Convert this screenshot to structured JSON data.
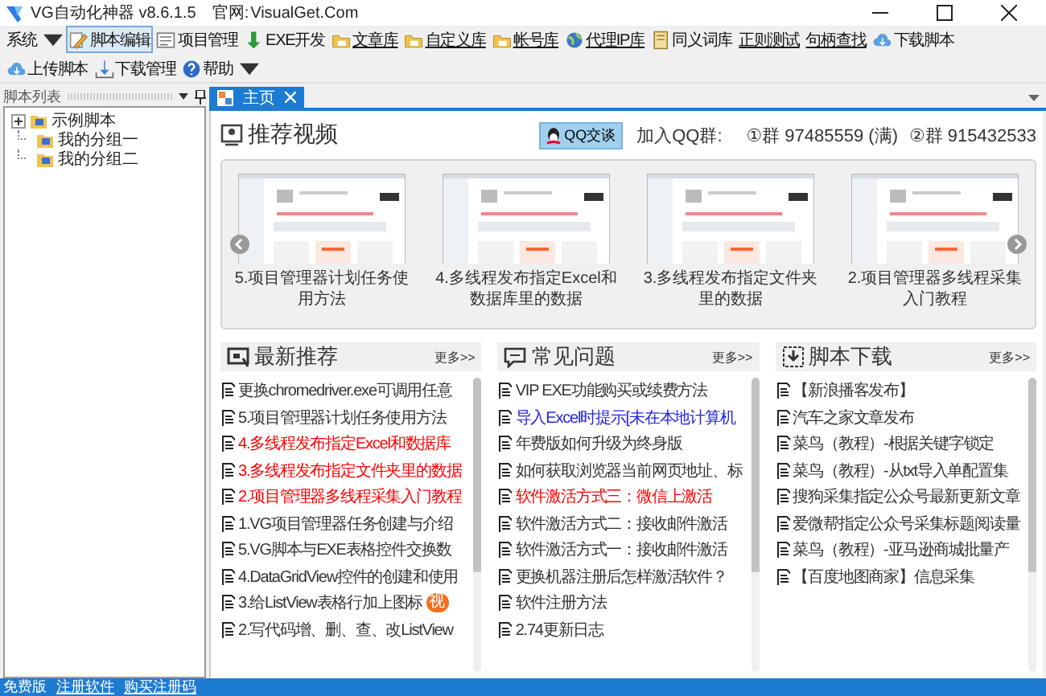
{
  "window": {
    "title": "VG自动化神器 v8.6.1.5",
    "site_label": "官网:",
    "site": "VisualGet.Com"
  },
  "toolbar": [
    {
      "label": "系统",
      "dropdown": true,
      "underlined": false,
      "selected": false
    },
    {
      "label": "脚本编辑",
      "dropdown": false,
      "underlined": false,
      "selected": true
    },
    {
      "label": "项目管理",
      "dropdown": false,
      "underlined": false,
      "selected": false
    },
    {
      "label": "EXE开发",
      "dropdown": false,
      "underlined": false,
      "selected": false
    },
    {
      "label": "文章库",
      "dropdown": false,
      "underlined": true,
      "selected": false
    },
    {
      "label": "自定义库",
      "dropdown": false,
      "underlined": true,
      "selected": false
    },
    {
      "label": "帐号库",
      "dropdown": false,
      "underlined": true,
      "selected": false
    },
    {
      "label": "代理IP库",
      "dropdown": false,
      "underlined": true,
      "selected": false
    },
    {
      "label": "同义词库",
      "dropdown": false,
      "underlined": false,
      "selected": false
    },
    {
      "label": "正则测试",
      "dropdown": false,
      "underlined": true,
      "selected": false
    },
    {
      "label": "句柄查找",
      "dropdown": false,
      "underlined": true,
      "selected": false
    },
    {
      "label": "下载脚本",
      "dropdown": false,
      "underlined": false,
      "selected": false
    },
    {
      "label": "上传脚本",
      "dropdown": false,
      "underlined": false,
      "selected": false
    },
    {
      "label": "下载管理",
      "dropdown": false,
      "underlined": false,
      "selected": false
    },
    {
      "label": "帮助",
      "dropdown": true,
      "underlined": false,
      "selected": false
    }
  ],
  "sidebar": {
    "title": "脚本列表",
    "items": [
      {
        "label": "示例脚本",
        "kind": "collapsed"
      },
      {
        "label": "我的分组一",
        "kind": "leaf"
      },
      {
        "label": "我的分组二",
        "kind": "leaf"
      }
    ]
  },
  "tabs": [
    {
      "label": "主页",
      "selected": true
    }
  ],
  "videos": {
    "title": "推荐视频",
    "qq_button": "QQ交谈",
    "join_label": "加入QQ群:",
    "groups": [
      "①群 97485559 (满)",
      "②群 915432533"
    ],
    "items": [
      {
        "caption": "5.项目管理器计划任务使用方法"
      },
      {
        "caption": "4.多线程发布指定Excel和数据库里的数据"
      },
      {
        "caption": "3.多线程发布指定文件夹里的数据"
      },
      {
        "caption": "2.项目管理器多线程采集入门教程"
      }
    ]
  },
  "columns": [
    {
      "title": "最新推荐",
      "more": "更多>>",
      "items": [
        {
          "text": "更换chromedriver.exe可调用任意",
          "color": "#333333"
        },
        {
          "text": "5.项目管理器计划任务使用方法",
          "color": "#333333"
        },
        {
          "text": "4.多线程发布指定Excel和数据库",
          "color": "#ff0000"
        },
        {
          "text": "3.多线程发布指定文件夹里的数据",
          "color": "#ff0000"
        },
        {
          "text": "2.项目管理器多线程采集入门教程",
          "color": "#ff0000"
        },
        {
          "text": "1.VG项目管理器任务创建与介绍",
          "color": "#333333"
        },
        {
          "text": "5.VG脚本与EXE表格控件交换数",
          "color": "#333333"
        },
        {
          "text": "4.DataGridView控件的创建和使用",
          "color": "#333333"
        },
        {
          "text": "3.给ListView表格行加上图标",
          "color": "#333333",
          "badge": "视"
        },
        {
          "text": "2.写代码增、删、查、改ListView",
          "color": "#333333"
        }
      ]
    },
    {
      "title": "常见问题",
      "more": "更多>>",
      "items": [
        {
          "text": "VIP EXE功能购买或续费方法",
          "color": "#333333"
        },
        {
          "text": "导入Excel时提示[未在本地计算机",
          "color": "#2222ee"
        },
        {
          "text": "年费版如何升级为终身版",
          "color": "#333333"
        },
        {
          "text": "如何获取浏览器当前网页地址、标",
          "color": "#333333"
        },
        {
          "text": "软件激活方式三：微信上激活",
          "color": "#ff0000"
        },
        {
          "text": "软件激活方式二：接收邮件激活",
          "color": "#333333"
        },
        {
          "text": "软件激活方式一：接收邮件激活",
          "color": "#333333"
        },
        {
          "text": "更换机器注册后怎样激活软件？",
          "color": "#333333"
        },
        {
          "text": "软件注册方法",
          "color": "#333333"
        },
        {
          "text": "2.74更新日志",
          "color": "#333333"
        }
      ]
    },
    {
      "title": "脚本下载",
      "more": "更多>>",
      "items": [
        {
          "text": "【新浪播客发布】",
          "color": "#333333"
        },
        {
          "text": "汽车之家文章发布",
          "color": "#333333"
        },
        {
          "text": "菜鸟（教程）-根据关键字锁定",
          "color": "#333333"
        },
        {
          "text": "菜鸟（教程）-从txt导入单配置集",
          "color": "#333333"
        },
        {
          "text": "搜狗采集指定公众号最新更新文章",
          "color": "#333333"
        },
        {
          "text": "爱微帮指定公众号采集标题阅读量",
          "color": "#333333"
        },
        {
          "text": "菜鸟（教程）-亚马逊商城批量产",
          "color": "#333333"
        },
        {
          "text": "【百度地图商家】信息采集",
          "color": "#333333"
        }
      ]
    }
  ],
  "status_bar": {
    "edition": "免费版",
    "links": [
      "注册软件",
      "购买注册码"
    ]
  }
}
